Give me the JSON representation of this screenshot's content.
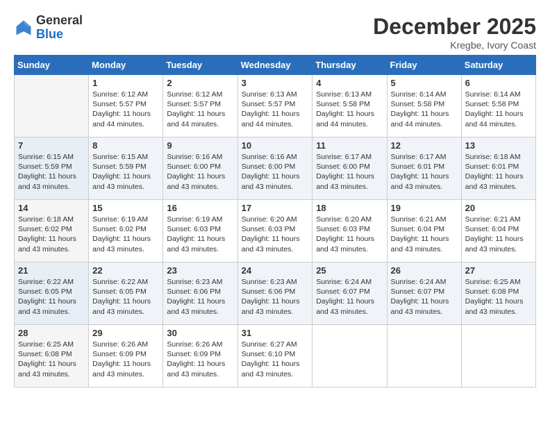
{
  "header": {
    "logo": {
      "general": "General",
      "blue": "Blue"
    },
    "title": "December 2025",
    "location": "Kregbe, Ivory Coast"
  },
  "days_of_week": [
    "Sunday",
    "Monday",
    "Tuesday",
    "Wednesday",
    "Thursday",
    "Friday",
    "Saturday"
  ],
  "weeks": [
    [
      {
        "day": "",
        "sunrise": "",
        "sunset": "",
        "daylight": ""
      },
      {
        "day": "1",
        "sunrise": "Sunrise: 6:12 AM",
        "sunset": "Sunset: 5:57 PM",
        "daylight": "Daylight: 11 hours and 44 minutes."
      },
      {
        "day": "2",
        "sunrise": "Sunrise: 6:12 AM",
        "sunset": "Sunset: 5:57 PM",
        "daylight": "Daylight: 11 hours and 44 minutes."
      },
      {
        "day": "3",
        "sunrise": "Sunrise: 6:13 AM",
        "sunset": "Sunset: 5:57 PM",
        "daylight": "Daylight: 11 hours and 44 minutes."
      },
      {
        "day": "4",
        "sunrise": "Sunrise: 6:13 AM",
        "sunset": "Sunset: 5:58 PM",
        "daylight": "Daylight: 11 hours and 44 minutes."
      },
      {
        "day": "5",
        "sunrise": "Sunrise: 6:14 AM",
        "sunset": "Sunset: 5:58 PM",
        "daylight": "Daylight: 11 hours and 44 minutes."
      },
      {
        "day": "6",
        "sunrise": "Sunrise: 6:14 AM",
        "sunset": "Sunset: 5:58 PM",
        "daylight": "Daylight: 11 hours and 44 minutes."
      }
    ],
    [
      {
        "day": "7",
        "sunrise": "Sunrise: 6:15 AM",
        "sunset": "Sunset: 5:59 PM",
        "daylight": "Daylight: 11 hours and 43 minutes."
      },
      {
        "day": "8",
        "sunrise": "Sunrise: 6:15 AM",
        "sunset": "Sunset: 5:59 PM",
        "daylight": "Daylight: 11 hours and 43 minutes."
      },
      {
        "day": "9",
        "sunrise": "Sunrise: 6:16 AM",
        "sunset": "Sunset: 6:00 PM",
        "daylight": "Daylight: 11 hours and 43 minutes."
      },
      {
        "day": "10",
        "sunrise": "Sunrise: 6:16 AM",
        "sunset": "Sunset: 6:00 PM",
        "daylight": "Daylight: 11 hours and 43 minutes."
      },
      {
        "day": "11",
        "sunrise": "Sunrise: 6:17 AM",
        "sunset": "Sunset: 6:00 PM",
        "daylight": "Daylight: 11 hours and 43 minutes."
      },
      {
        "day": "12",
        "sunrise": "Sunrise: 6:17 AM",
        "sunset": "Sunset: 6:01 PM",
        "daylight": "Daylight: 11 hours and 43 minutes."
      },
      {
        "day": "13",
        "sunrise": "Sunrise: 6:18 AM",
        "sunset": "Sunset: 6:01 PM",
        "daylight": "Daylight: 11 hours and 43 minutes."
      }
    ],
    [
      {
        "day": "14",
        "sunrise": "Sunrise: 6:18 AM",
        "sunset": "Sunset: 6:02 PM",
        "daylight": "Daylight: 11 hours and 43 minutes."
      },
      {
        "day": "15",
        "sunrise": "Sunrise: 6:19 AM",
        "sunset": "Sunset: 6:02 PM",
        "daylight": "Daylight: 11 hours and 43 minutes."
      },
      {
        "day": "16",
        "sunrise": "Sunrise: 6:19 AM",
        "sunset": "Sunset: 6:03 PM",
        "daylight": "Daylight: 11 hours and 43 minutes."
      },
      {
        "day": "17",
        "sunrise": "Sunrise: 6:20 AM",
        "sunset": "Sunset: 6:03 PM",
        "daylight": "Daylight: 11 hours and 43 minutes."
      },
      {
        "day": "18",
        "sunrise": "Sunrise: 6:20 AM",
        "sunset": "Sunset: 6:03 PM",
        "daylight": "Daylight: 11 hours and 43 minutes."
      },
      {
        "day": "19",
        "sunrise": "Sunrise: 6:21 AM",
        "sunset": "Sunset: 6:04 PM",
        "daylight": "Daylight: 11 hours and 43 minutes."
      },
      {
        "day": "20",
        "sunrise": "Sunrise: 6:21 AM",
        "sunset": "Sunset: 6:04 PM",
        "daylight": "Daylight: 11 hours and 43 minutes."
      }
    ],
    [
      {
        "day": "21",
        "sunrise": "Sunrise: 6:22 AM",
        "sunset": "Sunset: 6:05 PM",
        "daylight": "Daylight: 11 hours and 43 minutes."
      },
      {
        "day": "22",
        "sunrise": "Sunrise: 6:22 AM",
        "sunset": "Sunset: 6:05 PM",
        "daylight": "Daylight: 11 hours and 43 minutes."
      },
      {
        "day": "23",
        "sunrise": "Sunrise: 6:23 AM",
        "sunset": "Sunset: 6:06 PM",
        "daylight": "Daylight: 11 hours and 43 minutes."
      },
      {
        "day": "24",
        "sunrise": "Sunrise: 6:23 AM",
        "sunset": "Sunset: 6:06 PM",
        "daylight": "Daylight: 11 hours and 43 minutes."
      },
      {
        "day": "25",
        "sunrise": "Sunrise: 6:24 AM",
        "sunset": "Sunset: 6:07 PM",
        "daylight": "Daylight: 11 hours and 43 minutes."
      },
      {
        "day": "26",
        "sunrise": "Sunrise: 6:24 AM",
        "sunset": "Sunset: 6:07 PM",
        "daylight": "Daylight: 11 hours and 43 minutes."
      },
      {
        "day": "27",
        "sunrise": "Sunrise: 6:25 AM",
        "sunset": "Sunset: 6:08 PM",
        "daylight": "Daylight: 11 hours and 43 minutes."
      }
    ],
    [
      {
        "day": "28",
        "sunrise": "Sunrise: 6:25 AM",
        "sunset": "Sunset: 6:08 PM",
        "daylight": "Daylight: 11 hours and 43 minutes."
      },
      {
        "day": "29",
        "sunrise": "Sunrise: 6:26 AM",
        "sunset": "Sunset: 6:09 PM",
        "daylight": "Daylight: 11 hours and 43 minutes."
      },
      {
        "day": "30",
        "sunrise": "Sunrise: 6:26 AM",
        "sunset": "Sunset: 6:09 PM",
        "daylight": "Daylight: 11 hours and 43 minutes."
      },
      {
        "day": "31",
        "sunrise": "Sunrise: 6:27 AM",
        "sunset": "Sunset: 6:10 PM",
        "daylight": "Daylight: 11 hours and 43 minutes."
      },
      {
        "day": "",
        "sunrise": "",
        "sunset": "",
        "daylight": ""
      },
      {
        "day": "",
        "sunrise": "",
        "sunset": "",
        "daylight": ""
      },
      {
        "day": "",
        "sunrise": "",
        "sunset": "",
        "daylight": ""
      }
    ]
  ]
}
